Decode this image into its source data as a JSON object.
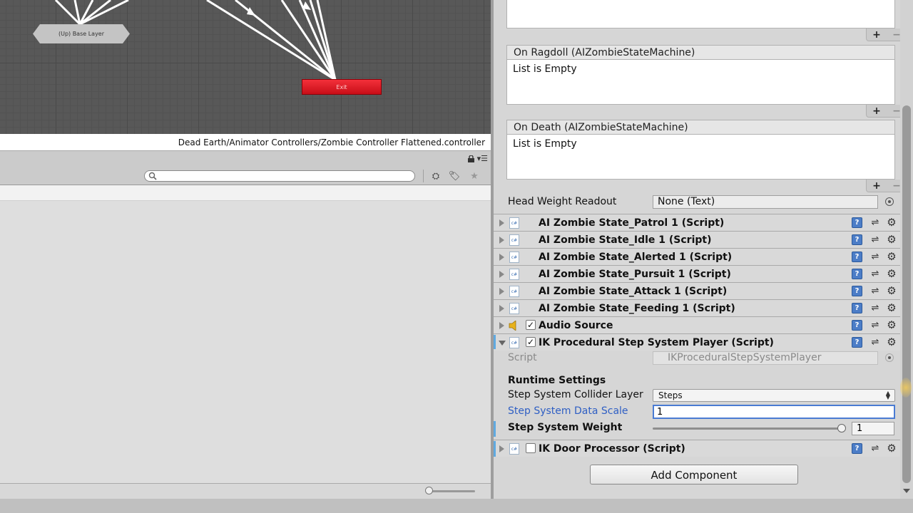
{
  "animator": {
    "base_layer_label": "(Up) Base Layer",
    "exit_label": "Exit",
    "path": "Dead Earth/Animator Controllers/Zombie Controller Flattened.controller",
    "exit_color": "#e0141f"
  },
  "project": {
    "search_placeholder": "",
    "icons": [
      "lock-icon",
      "menu-icon",
      "filter-by-type-icon",
      "tag-icon",
      "favorite-star-icon"
    ]
  },
  "inspector": {
    "events": [
      {
        "header": "",
        "body": ""
      },
      {
        "header": "On Ragdoll (AIZombieStateMachine)",
        "body": "List is Empty"
      },
      {
        "header": "On Death (AIZombieStateMachine)",
        "body": "List is Empty"
      }
    ],
    "plus": "+",
    "minus": "−",
    "head_weight": {
      "label": "Head Weight Readout",
      "value": "None (Text)"
    },
    "components": [
      {
        "name": "AI Zombie State_Patrol 1 (Script)",
        "icon": "csharp-script-icon"
      },
      {
        "name": "AI Zombie State_Idle 1 (Script)",
        "icon": "csharp-script-icon"
      },
      {
        "name": "AI Zombie State_Alerted 1 (Script)",
        "icon": "csharp-script-icon"
      },
      {
        "name": "AI Zombie State_Pursuit 1 (Script)",
        "icon": "csharp-script-icon"
      },
      {
        "name": "AI Zombie State_Attack 1 (Script)",
        "icon": "csharp-script-icon"
      },
      {
        "name": "AI Zombie State_Feeding 1 (Script)",
        "icon": "csharp-script-icon"
      },
      {
        "name": "Audio Source",
        "icon": "speaker-icon",
        "enabled": true
      },
      {
        "name": "IK Procedural Step System Player (Script)",
        "icon": "csharp-script-icon",
        "enabled": true
      },
      {
        "name": "IK Door Processor (Script)",
        "icon": "csharp-script-icon",
        "enabled": false
      }
    ],
    "ik_player": {
      "script_label": "Script",
      "script_value": "IKProceduralStepSystemPlayer",
      "section": "Runtime Settings",
      "collider_layer_label": "Step System Collider Layer",
      "collider_layer_value": "Steps",
      "data_scale_label": "Step System Data Scale",
      "data_scale_value": "1",
      "weight_label": "Step System Weight",
      "weight_value": "1",
      "weight_fraction": 1.0
    },
    "add_component": "Add Component",
    "accent_color": "#4a7bd3",
    "modified_color": "#5fa9e0"
  }
}
